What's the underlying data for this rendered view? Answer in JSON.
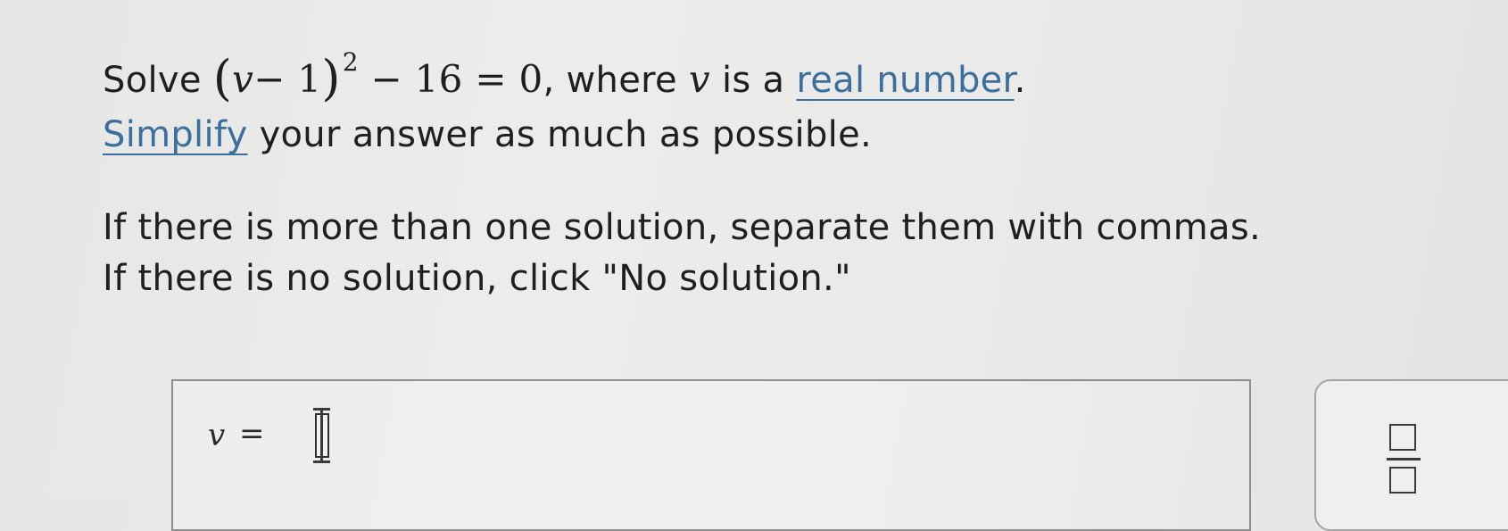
{
  "problem": {
    "line1": {
      "solve": "Solve",
      "open_paren": "(",
      "var": "v",
      "minus_one": "− 1",
      "close_paren": ")",
      "exponent": "2",
      "rest": "− 16 = 0",
      "where": ", where",
      "var2": "v",
      "is_a": "is a",
      "link_real_number": "real number",
      "period": "."
    },
    "line2": {
      "link_simplify": "Simplify",
      "rest": "your answer as much as possible."
    },
    "line3": "If there is more than one solution, separate them with commas.",
    "line4": "If there is no solution, click \"No solution.\""
  },
  "answer": {
    "variable": "v",
    "equals": "=",
    "input_value": ""
  },
  "tools": {
    "fraction_button": "fraction-icon"
  },
  "colors": {
    "link": "#3b6f9e",
    "text": "#1f1f1f"
  }
}
